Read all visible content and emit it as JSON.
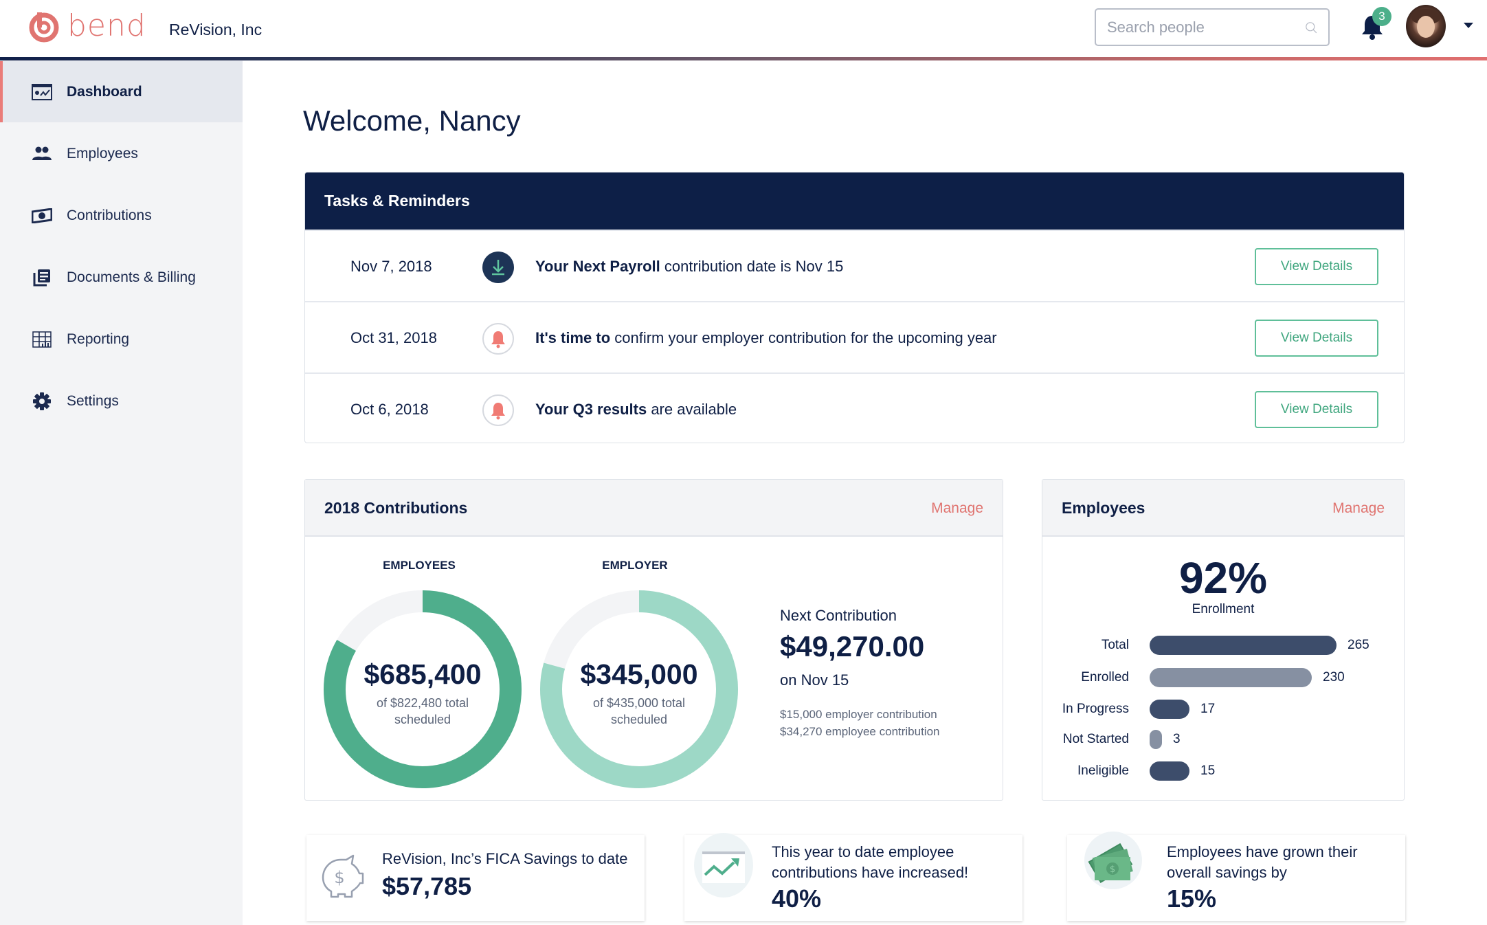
{
  "header": {
    "brand": "bend",
    "company": "ReVision, Inc",
    "search_placeholder": "Search people",
    "notification_count": "3",
    "brand_color": "#e07470"
  },
  "sidebar": {
    "items": [
      {
        "label": "Dashboard",
        "icon": "dashboard-icon",
        "active": true
      },
      {
        "label": "Employees",
        "icon": "people-icon",
        "active": false
      },
      {
        "label": "Contributions",
        "icon": "money-icon",
        "active": false
      },
      {
        "label": "Documents & Billing",
        "icon": "documents-icon",
        "active": false
      },
      {
        "label": "Reporting",
        "icon": "reporting-icon",
        "active": false
      },
      {
        "label": "Settings",
        "icon": "gear-icon",
        "active": false
      }
    ]
  },
  "main": {
    "welcome": "Welcome, Nancy",
    "tasks": {
      "title": "Tasks & Reminders",
      "button_label": "View Details",
      "items": [
        {
          "date": "Nov 7, 2018",
          "icon": "download-icon",
          "bold": "Your Next Payroll",
          "text": " contribution date is Nov 15"
        },
        {
          "date": "Oct 31, 2018",
          "icon": "bell-icon",
          "bold": "It's time to",
          "text": " confirm your employer contribution for the upcoming year"
        },
        {
          "date": "Oct 6, 2018",
          "icon": "bell-icon",
          "bold": "Your Q3 results",
          "text": " are available"
        }
      ]
    },
    "contributions": {
      "title": "2018 Contributions",
      "manage": "Manage",
      "employees": {
        "label": "EMPLOYEES",
        "amount": "$685,400",
        "sub1": "of $822,480 total",
        "sub2": "scheduled",
        "value": 685400,
        "total": 822480,
        "color": "#4fae8c"
      },
      "employer": {
        "label": "EMPLOYER",
        "amount": "$345,000",
        "sub1": "of $435,000 total",
        "sub2": "scheduled",
        "value": 345000,
        "total": 435000,
        "color": "#9dd8c6"
      },
      "next": {
        "label": "Next Contribution",
        "amount": "$49,270.00",
        "date": "on Nov 15",
        "employer_line": "$15,000 employer contribution",
        "employee_line": "$34,270 employee contribution"
      }
    },
    "employees": {
      "title": "Employees",
      "manage": "Manage",
      "enrollment_pct": "92%",
      "enrollment_label": "Enrollment",
      "bars": [
        {
          "label": "Total",
          "value": 265,
          "display": "265",
          "shade": "dark"
        },
        {
          "label": "Enrolled",
          "value": 230,
          "display": "230",
          "shade": "light"
        },
        {
          "label": "In Progress",
          "value": 17,
          "display": "17",
          "shade": "dark"
        },
        {
          "label": "Not Started",
          "value": 3,
          "display": "3",
          "shade": "light"
        },
        {
          "label": "Ineligible",
          "value": 15,
          "display": "15",
          "shade": "dark"
        }
      ]
    },
    "cards": [
      {
        "text": "ReVision, Inc’s FICA Savings to date",
        "value": "$57,785",
        "icon": "piggy-bank-icon"
      },
      {
        "text1": "This year to date employee",
        "text2": "contributions have increased!",
        "value": "40%",
        "icon": "trend-chart-icon"
      },
      {
        "text1": "Employees have grown their",
        "text2": "overall savings by",
        "value": "15%",
        "icon": "cash-icon"
      }
    ]
  }
}
